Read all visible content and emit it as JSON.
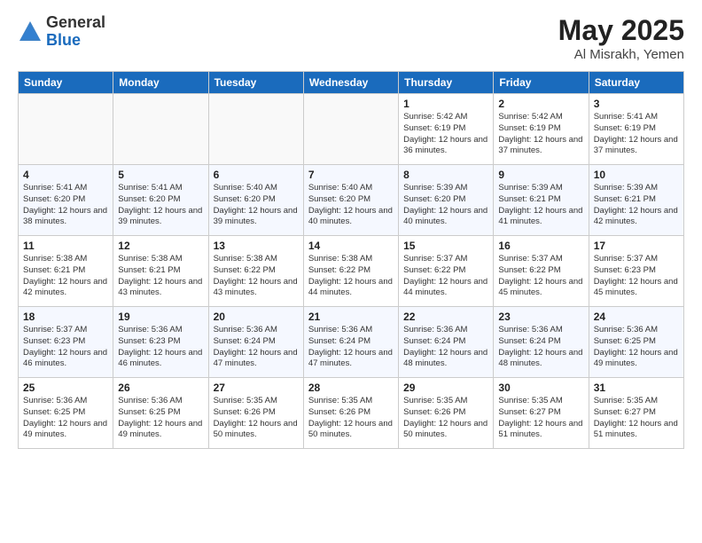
{
  "logo": {
    "general": "General",
    "blue": "Blue"
  },
  "title": "May 2025",
  "location": "Al Misrakh, Yemen",
  "days_of_week": [
    "Sunday",
    "Monday",
    "Tuesday",
    "Wednesday",
    "Thursday",
    "Friday",
    "Saturday"
  ],
  "weeks": [
    [
      {
        "day": "",
        "info": ""
      },
      {
        "day": "",
        "info": ""
      },
      {
        "day": "",
        "info": ""
      },
      {
        "day": "",
        "info": ""
      },
      {
        "day": "1",
        "info": "Sunrise: 5:42 AM\nSunset: 6:19 PM\nDaylight: 12 hours and 36 minutes."
      },
      {
        "day": "2",
        "info": "Sunrise: 5:42 AM\nSunset: 6:19 PM\nDaylight: 12 hours and 37 minutes."
      },
      {
        "day": "3",
        "info": "Sunrise: 5:41 AM\nSunset: 6:19 PM\nDaylight: 12 hours and 37 minutes."
      }
    ],
    [
      {
        "day": "4",
        "info": "Sunrise: 5:41 AM\nSunset: 6:20 PM\nDaylight: 12 hours and 38 minutes."
      },
      {
        "day": "5",
        "info": "Sunrise: 5:41 AM\nSunset: 6:20 PM\nDaylight: 12 hours and 39 minutes."
      },
      {
        "day": "6",
        "info": "Sunrise: 5:40 AM\nSunset: 6:20 PM\nDaylight: 12 hours and 39 minutes."
      },
      {
        "day": "7",
        "info": "Sunrise: 5:40 AM\nSunset: 6:20 PM\nDaylight: 12 hours and 40 minutes."
      },
      {
        "day": "8",
        "info": "Sunrise: 5:39 AM\nSunset: 6:20 PM\nDaylight: 12 hours and 40 minutes."
      },
      {
        "day": "9",
        "info": "Sunrise: 5:39 AM\nSunset: 6:21 PM\nDaylight: 12 hours and 41 minutes."
      },
      {
        "day": "10",
        "info": "Sunrise: 5:39 AM\nSunset: 6:21 PM\nDaylight: 12 hours and 42 minutes."
      }
    ],
    [
      {
        "day": "11",
        "info": "Sunrise: 5:38 AM\nSunset: 6:21 PM\nDaylight: 12 hours and 42 minutes."
      },
      {
        "day": "12",
        "info": "Sunrise: 5:38 AM\nSunset: 6:21 PM\nDaylight: 12 hours and 43 minutes."
      },
      {
        "day": "13",
        "info": "Sunrise: 5:38 AM\nSunset: 6:22 PM\nDaylight: 12 hours and 43 minutes."
      },
      {
        "day": "14",
        "info": "Sunrise: 5:38 AM\nSunset: 6:22 PM\nDaylight: 12 hours and 44 minutes."
      },
      {
        "day": "15",
        "info": "Sunrise: 5:37 AM\nSunset: 6:22 PM\nDaylight: 12 hours and 44 minutes."
      },
      {
        "day": "16",
        "info": "Sunrise: 5:37 AM\nSunset: 6:22 PM\nDaylight: 12 hours and 45 minutes."
      },
      {
        "day": "17",
        "info": "Sunrise: 5:37 AM\nSunset: 6:23 PM\nDaylight: 12 hours and 45 minutes."
      }
    ],
    [
      {
        "day": "18",
        "info": "Sunrise: 5:37 AM\nSunset: 6:23 PM\nDaylight: 12 hours and 46 minutes."
      },
      {
        "day": "19",
        "info": "Sunrise: 5:36 AM\nSunset: 6:23 PM\nDaylight: 12 hours and 46 minutes."
      },
      {
        "day": "20",
        "info": "Sunrise: 5:36 AM\nSunset: 6:24 PM\nDaylight: 12 hours and 47 minutes."
      },
      {
        "day": "21",
        "info": "Sunrise: 5:36 AM\nSunset: 6:24 PM\nDaylight: 12 hours and 47 minutes."
      },
      {
        "day": "22",
        "info": "Sunrise: 5:36 AM\nSunset: 6:24 PM\nDaylight: 12 hours and 48 minutes."
      },
      {
        "day": "23",
        "info": "Sunrise: 5:36 AM\nSunset: 6:24 PM\nDaylight: 12 hours and 48 minutes."
      },
      {
        "day": "24",
        "info": "Sunrise: 5:36 AM\nSunset: 6:25 PM\nDaylight: 12 hours and 49 minutes."
      }
    ],
    [
      {
        "day": "25",
        "info": "Sunrise: 5:36 AM\nSunset: 6:25 PM\nDaylight: 12 hours and 49 minutes."
      },
      {
        "day": "26",
        "info": "Sunrise: 5:36 AM\nSunset: 6:25 PM\nDaylight: 12 hours and 49 minutes."
      },
      {
        "day": "27",
        "info": "Sunrise: 5:35 AM\nSunset: 6:26 PM\nDaylight: 12 hours and 50 minutes."
      },
      {
        "day": "28",
        "info": "Sunrise: 5:35 AM\nSunset: 6:26 PM\nDaylight: 12 hours and 50 minutes."
      },
      {
        "day": "29",
        "info": "Sunrise: 5:35 AM\nSunset: 6:26 PM\nDaylight: 12 hours and 50 minutes."
      },
      {
        "day": "30",
        "info": "Sunrise: 5:35 AM\nSunset: 6:27 PM\nDaylight: 12 hours and 51 minutes."
      },
      {
        "day": "31",
        "info": "Sunrise: 5:35 AM\nSunset: 6:27 PM\nDaylight: 12 hours and 51 minutes."
      }
    ]
  ]
}
